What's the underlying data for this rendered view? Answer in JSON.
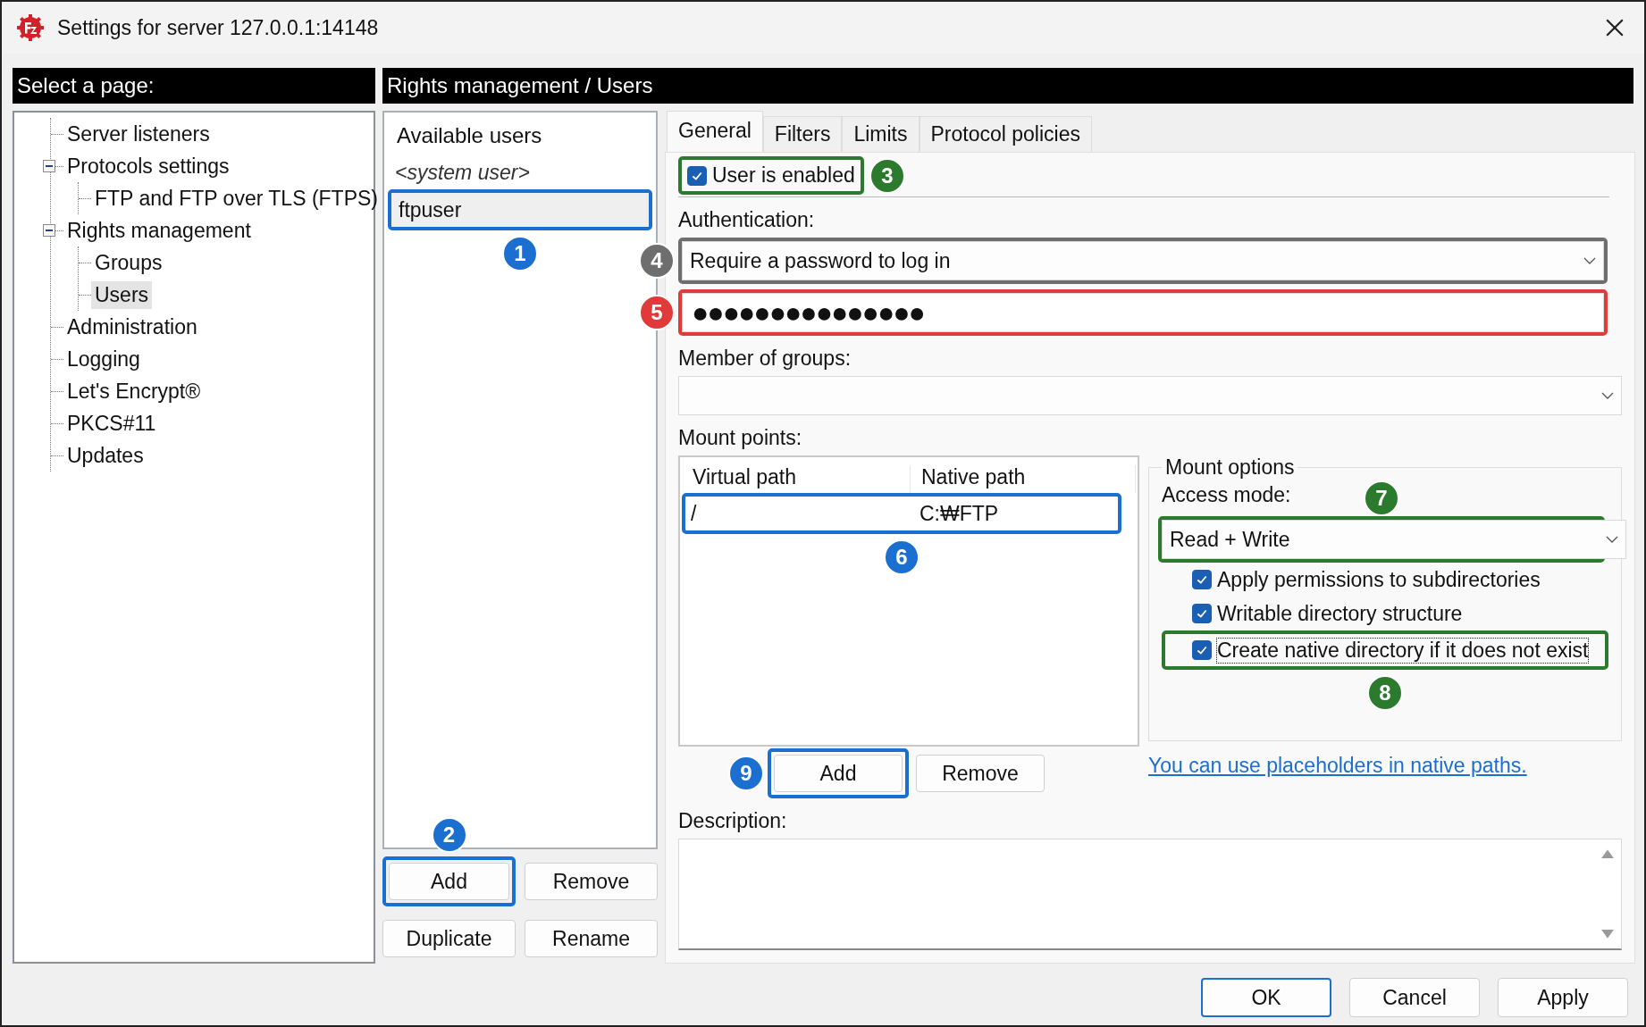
{
  "window": {
    "title": "Settings for server 127.0.0.1:14148"
  },
  "page_list": {
    "header": "Select a page:",
    "items": [
      {
        "label": "Server listeners",
        "selected": false
      },
      {
        "label": "Protocols settings",
        "selected": false,
        "expanded": true,
        "children": [
          {
            "label": "FTP and FTP over TLS (FTPS)",
            "selected": false
          }
        ]
      },
      {
        "label": "Rights management",
        "selected": false,
        "expanded": true,
        "children": [
          {
            "label": "Groups",
            "selected": false
          },
          {
            "label": "Users",
            "selected": true
          }
        ]
      },
      {
        "label": "Administration",
        "selected": false
      },
      {
        "label": "Logging",
        "selected": false
      },
      {
        "label": "Let's Encrypt®",
        "selected": false
      },
      {
        "label": "PKCS#11",
        "selected": false
      },
      {
        "label": "Updates",
        "selected": false
      }
    ]
  },
  "page_header": "Rights management / Users",
  "users": {
    "heading": "Available users",
    "items": [
      {
        "label": "<system user>",
        "kind": "system",
        "selected": false
      },
      {
        "label": "ftpuser",
        "kind": "user",
        "selected": true,
        "callout": {
          "number": "1",
          "color": "#1b6fd0"
        }
      }
    ],
    "buttons": [
      {
        "label": "Add",
        "callout": {
          "number": "2",
          "color": "#1b6fd0"
        }
      },
      {
        "label": "Remove"
      },
      {
        "label": "Duplicate"
      },
      {
        "label": "Rename"
      }
    ]
  },
  "tabs": [
    {
      "label": "General",
      "selected": true
    },
    {
      "label": "Filters",
      "selected": false
    },
    {
      "label": "Limits",
      "selected": false
    },
    {
      "label": "Protocol policies",
      "selected": false
    }
  ],
  "general": {
    "enabled": {
      "label": "User is enabled",
      "checked": true,
      "callout": {
        "number": "3",
        "color": "#2b7a2e"
      }
    },
    "authentication": {
      "label": "Authentication:",
      "value": "Require a password to log in",
      "callout": {
        "number": "4",
        "color": "#6e6e6e"
      }
    },
    "password": {
      "value": "●●●●●●●●●●●●●●●",
      "callout": {
        "number": "5",
        "color": "#e03a3a"
      }
    },
    "groups": {
      "label": "Member of groups:"
    },
    "mount_points": {
      "label": "Mount points:",
      "columns": [
        "Virtual path",
        "Native path"
      ],
      "rows": [
        {
          "cells": [
            "/",
            "C:₩FTP"
          ],
          "callout": {
            "number": "6",
            "color": "#1b6fd0"
          }
        }
      ],
      "buttons": [
        {
          "label": "Add",
          "callout": {
            "number": "9",
            "color": "#1b6fd0"
          }
        },
        {
          "label": "Remove"
        }
      ]
    },
    "mount_options": {
      "legend": "Mount options",
      "access_label": "Access mode:",
      "access_value": "Read + Write",
      "access_callout": {
        "number": "7",
        "color": "#2b7a2e"
      },
      "options": [
        {
          "label": "Apply permissions to subdirectories",
          "checked": true,
          "focused": false
        },
        {
          "label": "Writable directory structure",
          "checked": true,
          "focused": false
        },
        {
          "label": "Create native directory if it does not exist",
          "checked": true,
          "focused": true,
          "callout": {
            "number": "8",
            "color": "#2b7a2e"
          }
        }
      ]
    },
    "link": "You can use placeholders in native paths.",
    "description": {
      "label": "Description:"
    }
  },
  "footer": {
    "buttons": [
      {
        "label": "OK",
        "default": true
      },
      {
        "label": "Cancel",
        "default": false
      },
      {
        "label": "Apply",
        "default": false
      }
    ]
  }
}
